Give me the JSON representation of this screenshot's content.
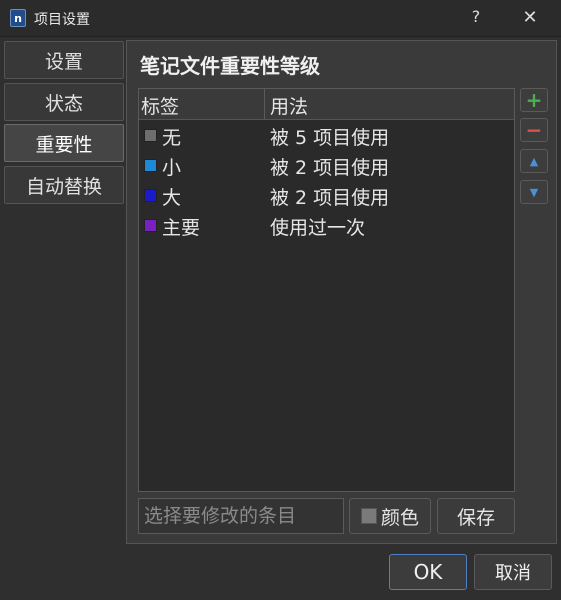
{
  "window": {
    "title": "项目设置",
    "help_glyph": "?",
    "close_glyph": "✕",
    "app_icon_letter": "n"
  },
  "tabs": [
    {
      "label": "设置"
    },
    {
      "label": "状态"
    },
    {
      "label": "重要性",
      "active": true
    },
    {
      "label": "自动替换"
    }
  ],
  "panel": {
    "title": "笔记文件重要性等级",
    "columns": {
      "tag": "标签",
      "usage": "用法"
    },
    "rows": [
      {
        "tag": "无",
        "usage": "被 5 项目使用",
        "color": "#6e6e6e"
      },
      {
        "tag": "小",
        "usage": "被 2 项目使用",
        "color": "#1e88d8"
      },
      {
        "tag": "大",
        "usage": "被 2 项目使用",
        "color": "#1a1ac8"
      },
      {
        "tag": "主要",
        "usage": "使用过一次",
        "color": "#7a1fc0"
      }
    ],
    "side_buttons": [
      {
        "icon": "plus-icon",
        "glyph": "+",
        "color": "#4caf50"
      },
      {
        "icon": "minus-icon",
        "glyph": "−",
        "color": "#d9534f"
      },
      {
        "icon": "chevron-up-icon",
        "glyph": "▲",
        "color": "#4a90d9"
      },
      {
        "icon": "chevron-down-icon",
        "glyph": "▼",
        "color": "#4a90d9"
      }
    ],
    "select_placeholder": "选择要修改的条目",
    "color_button": "颜色",
    "save_button": "保存"
  },
  "footer": {
    "ok": "OK",
    "cancel": "取消"
  }
}
